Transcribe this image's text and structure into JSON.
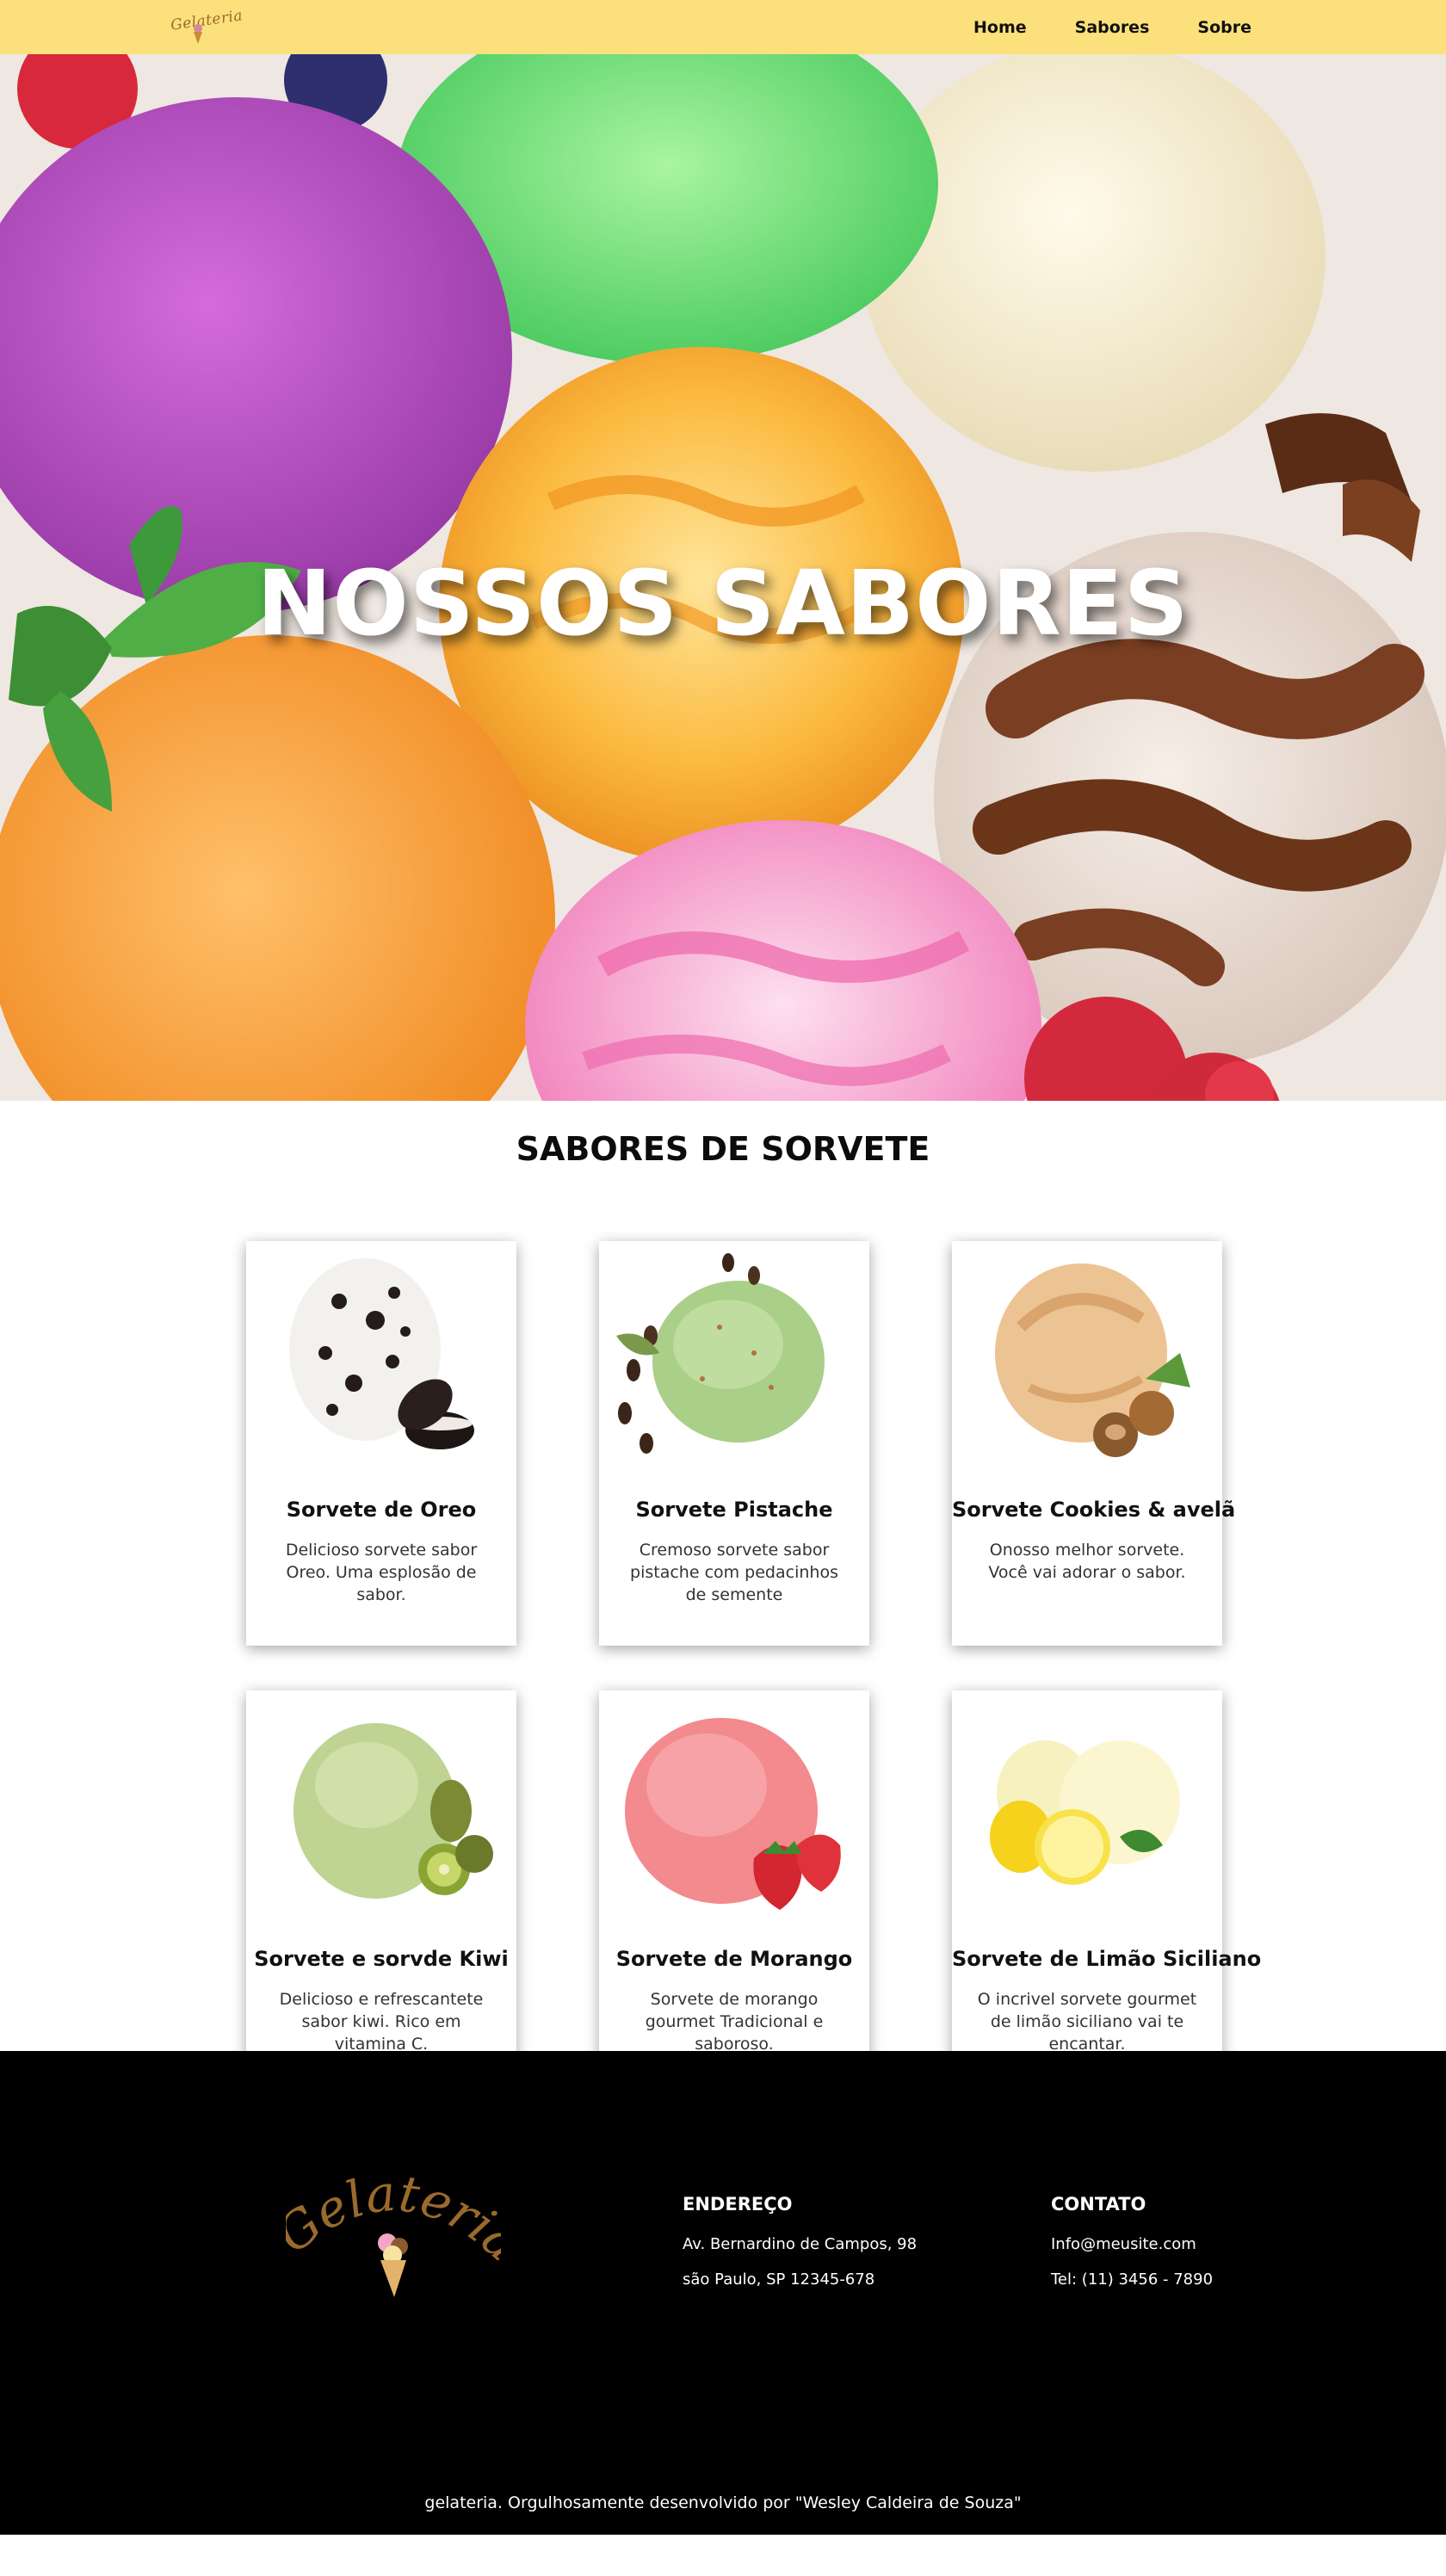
{
  "nav": {
    "logo_text": "Gelateria",
    "items": [
      {
        "label": "Home"
      },
      {
        "label": "Sabores"
      },
      {
        "label": "Sobre"
      }
    ]
  },
  "hero": {
    "title": "NOSSOS SABORES"
  },
  "flavors": {
    "section_title": "SABORES DE SORVETE",
    "cards": [
      {
        "title": "Sorvete de Oreo",
        "description": "Delicioso sorvete sabor Oreo. Uma esplosão de sabor.",
        "image": "oreo-icecream-icon"
      },
      {
        "title": "Sorvete Pistache",
        "description": "Cremoso sorvete sabor pistache com pedacinhos de semente",
        "image": "pistachio-icecream-icon"
      },
      {
        "title": "Sorvete Cookies & avelã",
        "description": "Onosso melhor sorvete. Você vai adorar o sabor.",
        "image": "hazelnut-icecream-icon"
      },
      {
        "title": "Sorvete e sorvde Kiwi",
        "description": "Delicioso e refrescantete sabor kiwi. Rico em vitamina C.",
        "image": "kiwi-icecream-icon"
      },
      {
        "title": "Sorvete de Morango",
        "description": "Sorvete de morango gourmet Tradicional e saboroso.",
        "image": "strawberry-icecream-icon"
      },
      {
        "title": "Sorvete de Limão Siciliano",
        "description": "O incrivel sorvete gourmet de limão siciliano vai te encantar.",
        "image": "lemon-icecream-icon"
      }
    ]
  },
  "footer": {
    "logo_text": "Gelateria",
    "address": {
      "heading": "ENDEREÇO",
      "line1": "Av. Bernardino de Campos, 98",
      "line2": "são Paulo, SP 12345-678"
    },
    "contact": {
      "heading": "CONTATO",
      "email": "Info@meusite.com",
      "phone": "Tel: (11) 3456 - 7890"
    },
    "copyright": "gelateria. Orgulhosamente desenvolvido por \"Wesley Caldeira de Souza\""
  },
  "colors": {
    "nav_background": "#fbe07c",
    "footer_background": "#000000",
    "logo_brown": "#9a6a2c"
  }
}
